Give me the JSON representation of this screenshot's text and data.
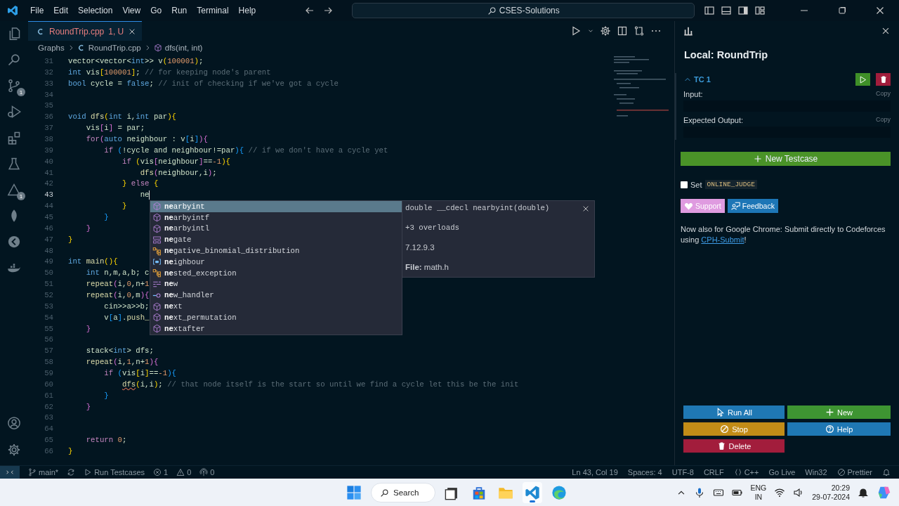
{
  "menu": [
    "File",
    "Edit",
    "Selection",
    "View",
    "Go",
    "Run",
    "Terminal",
    "Help"
  ],
  "command_center": "CSES-Solutions",
  "activity_bar": [
    {
      "kind": "files"
    },
    {
      "kind": "search"
    },
    {
      "kind": "branch",
      "badge": "1"
    },
    {
      "kind": "debug"
    },
    {
      "kind": "extensions"
    },
    {
      "kind": "flask"
    },
    {
      "kind": "triangle",
      "badge": "1"
    },
    {
      "kind": "leaf"
    },
    {
      "kind": "disc"
    },
    {
      "kind": "whale"
    }
  ],
  "activity_bottom": [
    {
      "kind": "account"
    },
    {
      "kind": "gear"
    }
  ],
  "tab": {
    "label": "RoundTrip.cpp",
    "status": "1, U"
  },
  "breadcrumbs": [
    {
      "kind": "folder",
      "text": "Graphs"
    },
    {
      "kind": "file",
      "text": "RoundTrip.cpp"
    },
    {
      "kind": "symbol",
      "text": "dfs(int, int)"
    }
  ],
  "code": [
    {
      "number": "31",
      "current": false,
      "tokens": [
        {
          "kind": "id",
          "text": "vector<vector<"
        },
        {
          "kind": "kw",
          "text": "int"
        },
        {
          "kind": "id",
          "text": ">> v"
        },
        {
          "kind": "b1",
          "text": "("
        },
        {
          "kind": "num",
          "text": "100001"
        },
        {
          "kind": "b1",
          "text": ")"
        },
        {
          "kind": "id",
          "text": ";"
        }
      ]
    },
    {
      "number": "32",
      "current": false,
      "tokens": [
        {
          "kind": "kw",
          "text": "int"
        },
        {
          "kind": "id",
          "text": " vis"
        },
        {
          "kind": "b1",
          "text": "["
        },
        {
          "kind": "num",
          "text": "100001"
        },
        {
          "kind": "b1",
          "text": "]"
        },
        {
          "kind": "id",
          "text": "; "
        },
        {
          "kind": "cmt",
          "text": "// for keeping node's parent"
        }
      ]
    },
    {
      "number": "33",
      "current": false,
      "tokens": [
        {
          "kind": "kw",
          "text": "bool"
        },
        {
          "kind": "id",
          "text": " cycle = "
        },
        {
          "kind": "kw",
          "text": "false"
        },
        {
          "kind": "id",
          "text": "; "
        },
        {
          "kind": "cmt",
          "text": "// init of checking if we've got a cycle"
        }
      ]
    },
    {
      "number": "34",
      "current": false
    },
    {
      "number": "35",
      "current": false
    },
    {
      "number": "36",
      "current": false,
      "tokens": [
        {
          "kind": "kw",
          "text": "void"
        },
        {
          "kind": "fn",
          "text": " dfs"
        },
        {
          "kind": "b1",
          "text": "("
        },
        {
          "kind": "kw",
          "text": "int"
        },
        {
          "kind": "id",
          "text": " i,"
        },
        {
          "kind": "kw",
          "text": "int"
        },
        {
          "kind": "id",
          "text": " par"
        },
        {
          "kind": "b1",
          "text": "){"
        }
      ]
    },
    {
      "number": "37",
      "current": false,
      "tokens": [
        {
          "kind": "id",
          "text": "    vis"
        },
        {
          "kind": "b2",
          "text": "["
        },
        {
          "kind": "id",
          "text": "i"
        },
        {
          "kind": "b2",
          "text": "]"
        },
        {
          "kind": "id",
          "text": " = par;"
        }
      ]
    },
    {
      "number": "38",
      "current": false,
      "tokens": [
        {
          "kind": "ctl",
          "text": "    for"
        },
        {
          "kind": "b2",
          "text": "("
        },
        {
          "kind": "kw",
          "text": "auto"
        },
        {
          "kind": "id",
          "text": " neighbour : v"
        },
        {
          "kind": "b3",
          "text": "["
        },
        {
          "kind": "id",
          "text": "i"
        },
        {
          "kind": "b3",
          "text": "]"
        },
        {
          "kind": "b2",
          "text": "){"
        }
      ]
    },
    {
      "number": "39",
      "current": false,
      "tokens": [
        {
          "kind": "ctl",
          "text": "        if "
        },
        {
          "kind": "b3",
          "text": "("
        },
        {
          "kind": "id",
          "text": "!cycle and neighbour!=par"
        },
        {
          "kind": "b3",
          "text": "){"
        },
        {
          "kind": "cmt",
          "text": " // if we don't have a cycle yet"
        }
      ]
    },
    {
      "number": "40",
      "current": false,
      "tokens": [
        {
          "kind": "ctl",
          "text": "            if "
        },
        {
          "kind": "b1",
          "text": "("
        },
        {
          "kind": "id",
          "text": "vis"
        },
        {
          "kind": "b2",
          "text": "["
        },
        {
          "kind": "id",
          "text": "neighbour"
        },
        {
          "kind": "b2",
          "text": "]"
        },
        {
          "kind": "id",
          "text": "=="
        },
        {
          "kind": "num",
          "text": "-1"
        },
        {
          "kind": "b1",
          "text": "){"
        }
      ]
    },
    {
      "number": "41",
      "current": false,
      "tokens": [
        {
          "kind": "fn",
          "text": "                dfs"
        },
        {
          "kind": "b2",
          "text": "("
        },
        {
          "kind": "id",
          "text": "neighbour,i"
        },
        {
          "kind": "b2",
          "text": ")"
        },
        {
          "kind": "id",
          "text": ";"
        }
      ]
    },
    {
      "number": "42",
      "current": false,
      "tokens": [
        {
          "kind": "b1",
          "text": "            }"
        },
        {
          "kind": "ctl",
          "text": " else "
        },
        {
          "kind": "b1",
          "text": "{"
        }
      ]
    },
    {
      "number": "43",
      "current": true,
      "tokens": [
        {
          "kind": "id",
          "text": "                ne"
        }
      ]
    },
    {
      "number": "44",
      "current": false,
      "tokens": [
        {
          "kind": "b1",
          "text": "            }"
        }
      ]
    },
    {
      "number": "45",
      "current": false,
      "tokens": [
        {
          "kind": "b3",
          "text": "        }"
        }
      ]
    },
    {
      "number": "46",
      "current": false,
      "tokens": [
        {
          "kind": "b2",
          "text": "    }"
        }
      ]
    },
    {
      "number": "47",
      "current": false,
      "tokens": [
        {
          "kind": "b1",
          "text": "}"
        }
      ]
    },
    {
      "number": "48",
      "current": false
    },
    {
      "number": "49",
      "current": false,
      "tokens": [
        {
          "kind": "kw",
          "text": "int"
        },
        {
          "kind": "fn",
          "text": " main"
        },
        {
          "kind": "b1",
          "text": "(){"
        }
      ]
    },
    {
      "number": "50",
      "current": false,
      "tokens": [
        {
          "kind": "kw",
          "text": "    int"
        },
        {
          "kind": "id",
          "text": " n,m,a,b; c"
        }
      ]
    },
    {
      "number": "51",
      "current": false,
      "tokens": [
        {
          "kind": "fn",
          "text": "    repeat"
        },
        {
          "kind": "b2",
          "text": "("
        },
        {
          "kind": "id",
          "text": "i,"
        },
        {
          "kind": "num",
          "text": "0"
        },
        {
          "kind": "id",
          "text": ",n+"
        },
        {
          "kind": "num",
          "text": "1"
        }
      ]
    },
    {
      "number": "52",
      "current": false,
      "tokens": [
        {
          "kind": "fn",
          "text": "    repeat"
        },
        {
          "kind": "b2",
          "text": "("
        },
        {
          "kind": "id",
          "text": "i,"
        },
        {
          "kind": "num",
          "text": "0"
        },
        {
          "kind": "id",
          "text": ",m"
        },
        {
          "kind": "b2",
          "text": "){"
        }
      ]
    },
    {
      "number": "53",
      "current": false,
      "tokens": [
        {
          "kind": "id",
          "text": "        cin>>a>>b;"
        }
      ]
    },
    {
      "number": "54",
      "current": false,
      "tokens": [
        {
          "kind": "id",
          "text": "        v"
        },
        {
          "kind": "b3",
          "text": "["
        },
        {
          "kind": "id",
          "text": "a"
        },
        {
          "kind": "b3",
          "text": "]"
        },
        {
          "kind": "id",
          "text": "."
        },
        {
          "kind": "fn",
          "text": "push_"
        }
      ]
    },
    {
      "number": "55",
      "current": false,
      "tokens": [
        {
          "kind": "b2",
          "text": "    }"
        }
      ]
    },
    {
      "number": "56",
      "current": false
    },
    {
      "number": "57",
      "current": false,
      "tokens": [
        {
          "kind": "id",
          "text": "    stack<"
        },
        {
          "kind": "kw",
          "text": "int"
        },
        {
          "kind": "id",
          "text": "> dfs;"
        }
      ]
    },
    {
      "number": "58",
      "current": false,
      "tokens": [
        {
          "kind": "fn",
          "text": "    repeat"
        },
        {
          "kind": "b2",
          "text": "("
        },
        {
          "kind": "id",
          "text": "i,"
        },
        {
          "kind": "num",
          "text": "1"
        },
        {
          "kind": "id",
          "text": ",n+"
        },
        {
          "kind": "num",
          "text": "1"
        },
        {
          "kind": "b2",
          "text": "){"
        }
      ]
    },
    {
      "number": "59",
      "current": false,
      "tokens": [
        {
          "kind": "ctl",
          "text": "        if "
        },
        {
          "kind": "b3",
          "text": "("
        },
        {
          "kind": "id",
          "text": "vis"
        },
        {
          "kind": "b1",
          "text": "["
        },
        {
          "kind": "id",
          "text": "i"
        },
        {
          "kind": "b1",
          "text": "]"
        },
        {
          "kind": "id",
          "text": "=="
        },
        {
          "kind": "num",
          "text": "-1"
        },
        {
          "kind": "b3",
          "text": "){"
        }
      ]
    },
    {
      "number": "60",
      "current": false,
      "tokens": [
        {
          "kind": "warn",
          "text": "            dfs"
        },
        {
          "kind": "b1",
          "text": "("
        },
        {
          "kind": "id",
          "text": "i,i"
        },
        {
          "kind": "b1",
          "text": ")"
        },
        {
          "kind": "id",
          "text": "; "
        },
        {
          "kind": "cmt",
          "text": "// that node itself is the start so until we find a cycle let this be the init"
        }
      ]
    },
    {
      "number": "61",
      "current": false,
      "tokens": [
        {
          "kind": "b3",
          "text": "        }"
        }
      ]
    },
    {
      "number": "62",
      "current": false,
      "tokens": [
        {
          "kind": "b2",
          "text": "    }"
        }
      ]
    },
    {
      "number": "63",
      "current": false
    },
    {
      "number": "64",
      "current": false
    },
    {
      "number": "65",
      "current": false,
      "tokens": [
        {
          "kind": "ctl",
          "text": "    return "
        },
        {
          "kind": "num",
          "text": "0"
        },
        {
          "kind": "id",
          "text": ";"
        }
      ]
    },
    {
      "number": "66",
      "current": false,
      "tokens": [
        {
          "kind": "b1",
          "text": "}"
        }
      ]
    }
  ],
  "suggestions": [
    {
      "kind": "cube",
      "label": "**ne**arbyint",
      "selected": true
    },
    {
      "kind": "cube",
      "label": "**ne**arbyintf",
      "selected": false
    },
    {
      "kind": "cube",
      "label": "**ne**arbyintl",
      "selected": false
    },
    {
      "kind": "struct",
      "label": "**ne**gate",
      "selected": false
    },
    {
      "kind": "class",
      "label": "**ne**gative_binomial_distribution",
      "selected": false
    },
    {
      "kind": "variable",
      "label": "**ne**ighbour",
      "selected": false
    },
    {
      "kind": "class",
      "label": "**ne**sted_exception",
      "selected": false
    },
    {
      "kind": "keyword",
      "label": "**ne**w",
      "selected": false
    },
    {
      "kind": "link",
      "label": "**ne**w_handler",
      "selected": false
    },
    {
      "kind": "cube",
      "label": "**ne**xt",
      "selected": false
    },
    {
      "kind": "cube",
      "label": "**ne**xt_permutation",
      "selected": false
    },
    {
      "kind": "cube",
      "label": "**ne**xtafter",
      "selected": false
    }
  ],
  "suggestion_detail": {
    "signature": "double __cdecl nearbyint(double)",
    "overloads": "+3 overloads",
    "section": "7.12.9.3",
    "file": "**File:** math.h"
  },
  "panel": {
    "title": "Local: RoundTrip",
    "testcase": {
      "title": "TC 1",
      "expanded": true,
      "fields": [
        {
          "label": "Input:",
          "copy": "Copy"
        },
        {
          "label": "Expected Output:",
          "copy": "Copy"
        }
      ]
    },
    "new_testcase": "New Testcase",
    "online_judge": {
      "label": "Set",
      "code": "ONLINE_JUDGE",
      "checked": false
    },
    "support": "Support",
    "feedback": "Feedback",
    "note": {
      "text": "Now also for Google Chrome: Submit directly to Codeforces using ",
      "link": "CPH-Submit",
      "after": "!"
    },
    "actions": [
      {
        "kind": "run",
        "text": "Run All"
      },
      {
        "kind": "new",
        "text": "New"
      },
      {
        "kind": "stop",
        "text": "Stop"
      },
      {
        "kind": "help",
        "text": "Help"
      },
      {
        "kind": "delete",
        "text": "Delete"
      }
    ]
  },
  "status_left": [
    {
      "kind": "remote"
    },
    {
      "kind": "branch",
      "text": "main*"
    },
    {
      "kind": "sync"
    },
    {
      "kind": "run",
      "text": "Run Testcases"
    },
    {
      "kind": "error",
      "text": "1"
    },
    {
      "kind": "warning",
      "text": "0"
    },
    {
      "kind": "ports",
      "text": "0"
    }
  ],
  "status_right": [
    {
      "kind": "text",
      "text": "Ln 43, Col 19"
    },
    {
      "kind": "text",
      "text": "Spaces: 4"
    },
    {
      "kind": "text",
      "text": "UTF-8"
    },
    {
      "kind": "text",
      "text": "CRLF"
    },
    {
      "kind": "braces",
      "text": "C++"
    },
    {
      "kind": "broadcast",
      "text": "Go Live"
    },
    {
      "kind": "text",
      "text": "Win32"
    },
    {
      "kind": "prettier",
      "text": "Prettier"
    },
    {
      "kind": "bell"
    }
  ],
  "taskbar": {
    "apps": [
      {
        "kind": "windows",
        "selected": false
      },
      {
        "kind": "search",
        "text": "Search",
        "selected": false
      },
      {
        "kind": "taskview",
        "selected": false
      },
      {
        "kind": "store",
        "selected": false
      },
      {
        "kind": "folder",
        "selected": false
      },
      {
        "kind": "vscode",
        "selected": true
      },
      {
        "kind": "edge",
        "selected": false
      }
    ],
    "language": [
      "ENG",
      "IN"
    ],
    "time": "20:29",
    "date": "29-07-2024"
  }
}
